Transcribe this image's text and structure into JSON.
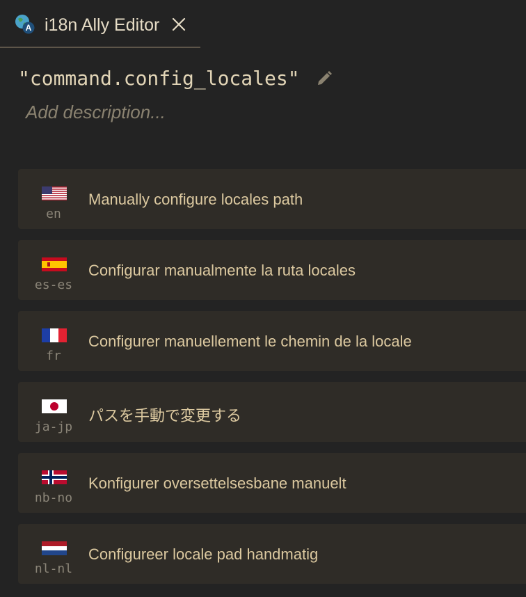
{
  "tab": {
    "title": "i18n Ally Editor",
    "icon": "i18n-globe-icon",
    "close_icon": "close-icon"
  },
  "key": {
    "text": "\"command.config_locales\"",
    "edit_icon": "pencil-icon"
  },
  "description": {
    "placeholder": "Add description..."
  },
  "translations": [
    {
      "locale": "en",
      "flag": "us-flag-icon",
      "text": "Manually configure locales path"
    },
    {
      "locale": "es-es",
      "flag": "spain-flag-icon",
      "text": "Configurar manualmente la ruta locales"
    },
    {
      "locale": "fr",
      "flag": "france-flag-icon",
      "text": "Configurer manuellement le chemin de la locale"
    },
    {
      "locale": "ja-jp",
      "flag": "japan-flag-icon",
      "text": "パスを手動で変更する"
    },
    {
      "locale": "nb-no",
      "flag": "norway-flag-icon",
      "text": "Konfigurer oversettelsesbane manuelt"
    },
    {
      "locale": "nl-nl",
      "flag": "netherlands-flag-icon",
      "text": "Configureer locale pad handmatig"
    }
  ],
  "colors": {
    "background": "#232323",
    "card": "#2f2c27",
    "text": "#dcc9a0",
    "muted": "#8b8578"
  }
}
